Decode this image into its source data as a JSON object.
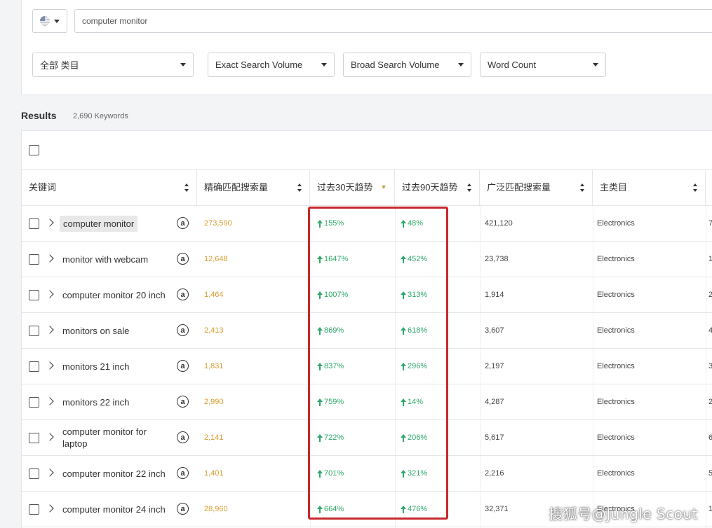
{
  "search": {
    "country": "us-flag",
    "query": "computer monitor"
  },
  "filters": {
    "category": "全部 类目",
    "exact_volume": "Exact Search Volume",
    "broad_volume": "Broad Search Volume",
    "word_count": "Word Count"
  },
  "results": {
    "title": "Results",
    "count": "2,690 Keywords"
  },
  "columns": {
    "keyword": "关键词",
    "exact": "精确匹配搜索量",
    "trend30": "过去30天趋势",
    "trend90": "过去90天趋势",
    "broad": "广泛匹配搜索量",
    "category": "主类目"
  },
  "rows": [
    {
      "keyword": "computer monitor",
      "exact": "273,590",
      "t30": "155%",
      "t90": "48%",
      "broad": "421,120",
      "category": "Electronics",
      "edge": "7"
    },
    {
      "keyword": "monitor with webcam",
      "exact": "12,648",
      "t30": "1647%",
      "t90": "452%",
      "broad": "23,738",
      "category": "Electronics",
      "edge": "1"
    },
    {
      "keyword": "computer monitor 20 inch",
      "exact": "1,464",
      "t30": "1007%",
      "t90": "313%",
      "broad": "1,914",
      "category": "Electronics",
      "edge": "2"
    },
    {
      "keyword": "monitors on sale",
      "exact": "2,413",
      "t30": "869%",
      "t90": "618%",
      "broad": "3,607",
      "category": "Electronics",
      "edge": "4"
    },
    {
      "keyword": "monitors 21 inch",
      "exact": "1,831",
      "t30": "837%",
      "t90": "296%",
      "broad": "2,197",
      "category": "Electronics",
      "edge": "3"
    },
    {
      "keyword": "monitors 22 inch",
      "exact": "2,990",
      "t30": "759%",
      "t90": "14%",
      "broad": "4,287",
      "category": "Electronics",
      "edge": "2"
    },
    {
      "keyword": "computer monitor for laptop",
      "exact": "2,141",
      "t30": "722%",
      "t90": "206%",
      "broad": "5,617",
      "category": "Electronics",
      "edge": "6"
    },
    {
      "keyword": "computer monitor 22 inch",
      "exact": "1,401",
      "t30": "701%",
      "t90": "321%",
      "broad": "2,216",
      "category": "Electronics",
      "edge": "5"
    },
    {
      "keyword": "computer monitor 24 inch",
      "exact": "28,960",
      "t30": "664%",
      "t90": "476%",
      "broad": "32,371",
      "category": "Electronics",
      "edge": "1"
    }
  ],
  "watermark": "搜狐号@Jungle Scout",
  "colors": {
    "exact_volume": "#d79b2d",
    "trend_up": "#2fa86a",
    "highlight_box": "#c8282d"
  }
}
